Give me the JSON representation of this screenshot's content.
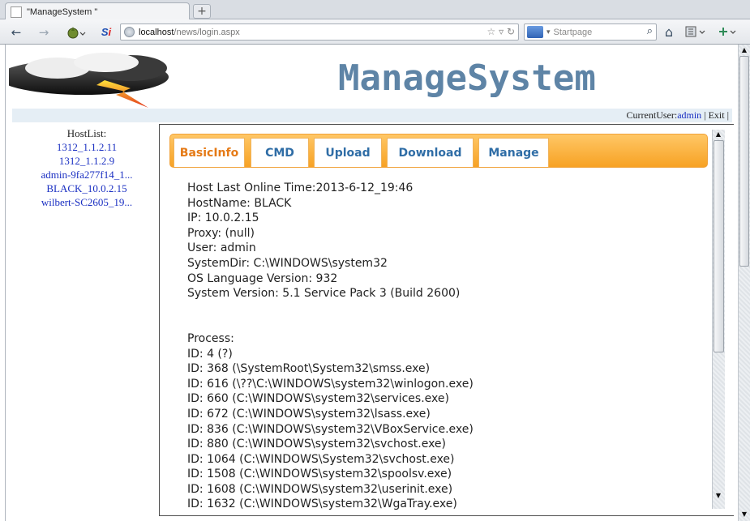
{
  "browser": {
    "tab_title": "\"ManageSystem \"",
    "new_tab_label": "+",
    "url_host": "localhost",
    "url_path": "/news/login.aspx",
    "search_placeholder": "Startpage"
  },
  "header": {
    "site_title": "ManageSystem"
  },
  "userbar": {
    "prefix": "CurrentUser:",
    "user": "admin",
    "sep1": "|",
    "exit": "Exit",
    "sep2": "|"
  },
  "hostlist": {
    "title": "HostList:",
    "items": [
      "1312_1.1.2.11",
      "1312_1.1.2.9",
      "admin-9fa277f14_1...",
      "BLACK_10.0.2.15",
      "wilbert-SC2605_19..."
    ]
  },
  "tabs": [
    {
      "label": "BasicInfo",
      "active": true
    },
    {
      "label": "CMD",
      "active": false
    },
    {
      "label": "Upload",
      "active": false
    },
    {
      "label": "Download",
      "active": false
    },
    {
      "label": "Manage",
      "active": false
    }
  ],
  "basic_info": [
    "Host Last Online Time:2013-6-12_19:46",
    "HostName: BLACK",
    "IP: 10.0.2.15",
    "Proxy: (null)",
    "User: admin",
    "SystemDir: C:\\WINDOWS\\system32",
    "OS Language Version: 932",
    "System Version: 5.1 Service Pack 3 (Build 2600)",
    "",
    "",
    "Process:",
    "ID: 4 (?)",
    "ID: 368 (\\SystemRoot\\System32\\smss.exe)",
    "ID: 616 (\\??\\C:\\WINDOWS\\system32\\winlogon.exe)",
    "ID: 660 (C:\\WINDOWS\\system32\\services.exe)",
    "ID: 672 (C:\\WINDOWS\\system32\\lsass.exe)",
    "ID: 836 (C:\\WINDOWS\\system32\\VBoxService.exe)",
    "ID: 880 (C:\\WINDOWS\\system32\\svchost.exe)",
    "ID: 1064 (C:\\WINDOWS\\System32\\svchost.exe)",
    "ID: 1508 (C:\\WINDOWS\\system32\\spoolsv.exe)",
    "ID: 1608 (C:\\WINDOWS\\system32\\userinit.exe)",
    "ID: 1632 (C:\\WINDOWS\\system32\\WgaTray.exe)"
  ],
  "colors": {
    "title": "#5e84a6",
    "tab_active": "#e57a16",
    "tab_inactive": "#2f6da6",
    "tabstrip": "#f7a224",
    "link": "#1a2fc2"
  }
}
